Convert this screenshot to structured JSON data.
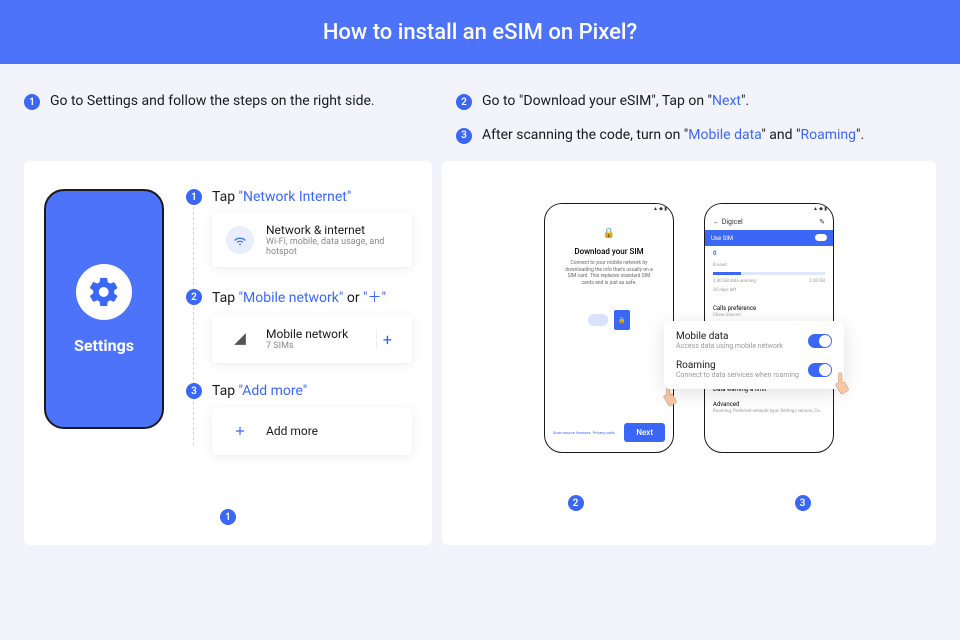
{
  "header": {
    "title": "How to install an eSIM on Pixel?"
  },
  "instructions": {
    "i1": "Go to Settings and follow the steps on the right side.",
    "i2_pre": "Go to \"Download your eSIM\", Tap on \"",
    "i2_link": "Next",
    "i2_post": "\".",
    "i3_pre": "After scanning the code, turn on \"",
    "i3_link1": "Mobile data",
    "i3_mid": "\" and \"",
    "i3_link2": "Roaming",
    "i3_post": "\"."
  },
  "settings_phone": {
    "label": "Settings"
  },
  "sub": {
    "s1_pre": "Tap ",
    "s1_link": "\"Network Internet\"",
    "s2_pre": "Tap ",
    "s2_link": "\"Mobile network\"",
    "s2_mid": " or ",
    "s2_link2": "\"＋\"",
    "s3_pre": "Tap ",
    "s3_link": "\"Add more\""
  },
  "cards": {
    "network": {
      "title": "Network & internet",
      "sub": "Wi-Fi, mobile, data usage, and hotspot"
    },
    "mobile": {
      "title": "Mobile network",
      "sub": "7 SIMs"
    },
    "addmore": {
      "title": "Add more"
    }
  },
  "phone2": {
    "title": "Download your SIM",
    "desc": "Connect to your mobile network by downloading the info that's usually on a SIM card. This replaces standard SIM cards and is just as safe.",
    "links": "Scan source licenses. Privacy polic",
    "next": "Next"
  },
  "phone3": {
    "carrier": "Digicel",
    "use_sim": "Use SIM",
    "used": "B used",
    "warn1": "2.00 GB data warning",
    "warn2": "30 days left",
    "limit": "2.00 GB",
    "calls_pref": "Calls preference",
    "calls_pref_sub": "China Unicom",
    "data_warn": "Data warning & limit",
    "advanced": "Advanced",
    "advanced_sub": "Roaming, Preferred network type, Settings version, Ca..."
  },
  "overlay": {
    "mobile_data": {
      "title": "Mobile data",
      "sub": "Access data using mobile network"
    },
    "roaming": {
      "title": "Roaming",
      "sub": "Connect to data services when roaming"
    }
  },
  "bullets": {
    "b1": "1",
    "b2": "2",
    "b3": "3"
  }
}
